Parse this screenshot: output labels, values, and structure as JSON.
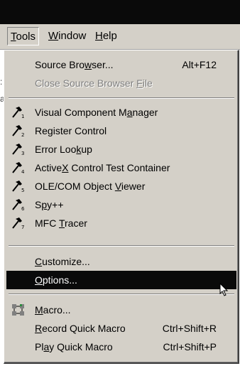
{
  "menubar": {
    "items": [
      {
        "label": "Tools",
        "active": true
      },
      {
        "label": "Window",
        "active": false
      },
      {
        "label": "Help",
        "active": false
      }
    ]
  },
  "menu": {
    "items": [
      {
        "type": "item",
        "label": "Source Browser...",
        "shortcut": "Alt+F12",
        "enabled": true
      },
      {
        "type": "item",
        "label": "Close Source Browser File",
        "shortcut": "",
        "enabled": false
      },
      {
        "type": "separator"
      },
      {
        "type": "item",
        "label": "Visual Component Manager",
        "icon": "hammer-1-icon",
        "enabled": true
      },
      {
        "type": "item",
        "label": "Register Control",
        "icon": "hammer-2-icon",
        "enabled": true
      },
      {
        "type": "item",
        "label": "Error Lookup",
        "icon": "hammer-3-icon",
        "enabled": true
      },
      {
        "type": "item",
        "label": "ActiveX Control Test Container",
        "icon": "hammer-4-icon",
        "enabled": true
      },
      {
        "type": "item",
        "label": "OLE/COM Object Viewer",
        "icon": "hammer-5-icon",
        "enabled": true
      },
      {
        "type": "item",
        "label": "Spy++",
        "icon": "hammer-6-icon",
        "enabled": true
      },
      {
        "type": "item",
        "label": "MFC Tracer",
        "icon": "hammer-7-icon",
        "enabled": true
      },
      {
        "type": "separator"
      },
      {
        "type": "item",
        "label": "Customize...",
        "enabled": true
      },
      {
        "type": "item",
        "label": "Options...",
        "enabled": true,
        "highlighted": true
      },
      {
        "type": "separator"
      },
      {
        "type": "item",
        "label": "Macro...",
        "icon": "macro-icon",
        "enabled": true
      },
      {
        "type": "item",
        "label": "Record Quick Macro",
        "shortcut": "Ctrl+Shift+R",
        "enabled": true
      },
      {
        "type": "item",
        "label": "Play Quick Macro",
        "shortcut": "Ctrl+Shift+P",
        "enabled": true
      }
    ]
  },
  "colors": {
    "menu_background": "#d4d0c8",
    "highlight": "#0a0a0a",
    "disabled_text": "#808080",
    "title_bar": "#0a0a0a"
  }
}
